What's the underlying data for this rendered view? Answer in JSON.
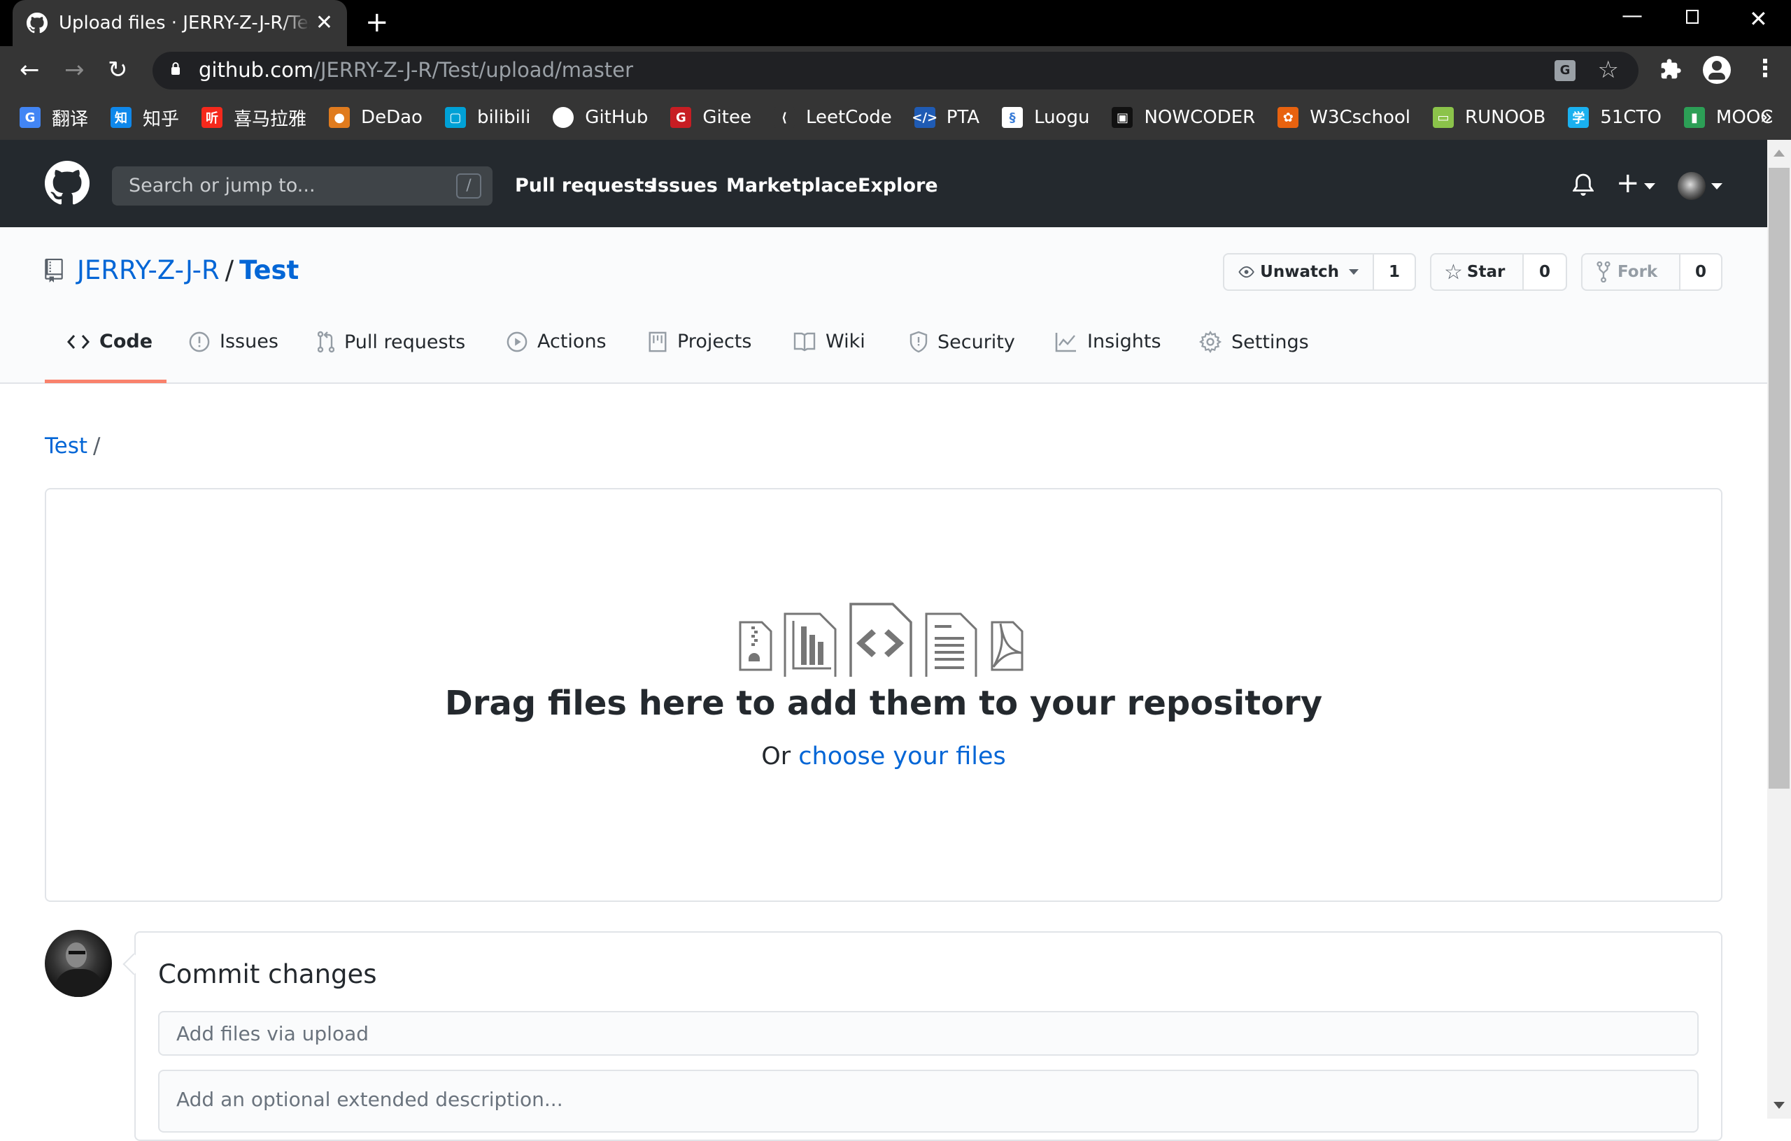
{
  "browser": {
    "tab_title": "Upload files · JERRY-Z-J-R/Test",
    "url_host": "github.com",
    "url_path": "/JERRY-Z-J-R/Test/upload/master",
    "bookmarks": [
      {
        "label": "翻译",
        "icon": "google-translate-icon",
        "color": "#4285f4",
        "glyph": "G"
      },
      {
        "label": "知乎",
        "icon": "zhihu-icon",
        "color": "#0f88eb",
        "glyph": "知"
      },
      {
        "label": "喜马拉雅",
        "icon": "ximalaya-icon",
        "color": "#f5291c",
        "glyph": "听"
      },
      {
        "label": "DeDao",
        "icon": "dedao-icon",
        "color": "#e07b1e",
        "glyph": "●"
      },
      {
        "label": "bilibili",
        "icon": "bilibili-icon",
        "color": "#00a1d6",
        "glyph": "▢"
      },
      {
        "label": "GitHub",
        "icon": "github-icon",
        "color": "#353535",
        "glyph": ""
      },
      {
        "label": "Gitee",
        "icon": "gitee-icon",
        "color": "#c71d23",
        "glyph": "G"
      },
      {
        "label": "LeetCode",
        "icon": "leetcode-icon",
        "color": "#353535",
        "glyph": "⟨"
      },
      {
        "label": "PTA",
        "icon": "pta-icon",
        "color": "#1f5bb4",
        "glyph": "</>"
      },
      {
        "label": "Luogu",
        "icon": "luogu-icon",
        "color": "#ffffff",
        "glyph": "§"
      },
      {
        "label": "NOWCODER",
        "icon": "nowcoder-icon",
        "color": "#111111",
        "glyph": "▣"
      },
      {
        "label": "W3Cschool",
        "icon": "w3cschool-icon",
        "color": "#e8620f",
        "glyph": "✿"
      },
      {
        "label": "RUNOOB",
        "icon": "runoob-icon",
        "color": "#8bc34a",
        "glyph": "▭"
      },
      {
        "label": "51CTO",
        "icon": "51cto-icon",
        "color": "#1ab1f0",
        "glyph": "学"
      },
      {
        "label": "MOOC",
        "icon": "mooc-icon",
        "color": "#2c9f56",
        "glyph": "▮"
      }
    ]
  },
  "github": {
    "search_placeholder": "Search or jump to...",
    "search_shortcut": "/",
    "nav": [
      "Pull requests",
      "Issues",
      "Marketplace",
      "Explore"
    ]
  },
  "repo": {
    "owner": "JERRY-Z-J-R",
    "separator": "/",
    "name": "Test",
    "watch": {
      "label": "Unwatch",
      "count": "1"
    },
    "star": {
      "label": "Star",
      "count": "0"
    },
    "fork": {
      "label": "Fork",
      "count": "0"
    },
    "tabs": [
      {
        "label": "Code",
        "icon": "code-icon",
        "active": true
      },
      {
        "label": "Issues",
        "icon": "issue-icon"
      },
      {
        "label": "Pull requests",
        "icon": "pull-request-icon"
      },
      {
        "label": "Actions",
        "icon": "play-icon"
      },
      {
        "label": "Projects",
        "icon": "project-icon"
      },
      {
        "label": "Wiki",
        "icon": "book-icon"
      },
      {
        "label": "Security",
        "icon": "shield-icon"
      },
      {
        "label": "Insights",
        "icon": "graph-icon"
      },
      {
        "label": "Settings",
        "icon": "gear-icon"
      }
    ],
    "accent": "#f9826c",
    "link_color": "#0366d6"
  },
  "breadcrumb": {
    "root": "Test",
    "separator": "/"
  },
  "dropzone": {
    "title": "Drag files here to add them to your repository",
    "or": "Or",
    "choose_link": "choose your files"
  },
  "commit": {
    "title": "Commit changes",
    "summary_placeholder": "Add files via upload",
    "description_placeholder": "Add an optional extended description..."
  }
}
